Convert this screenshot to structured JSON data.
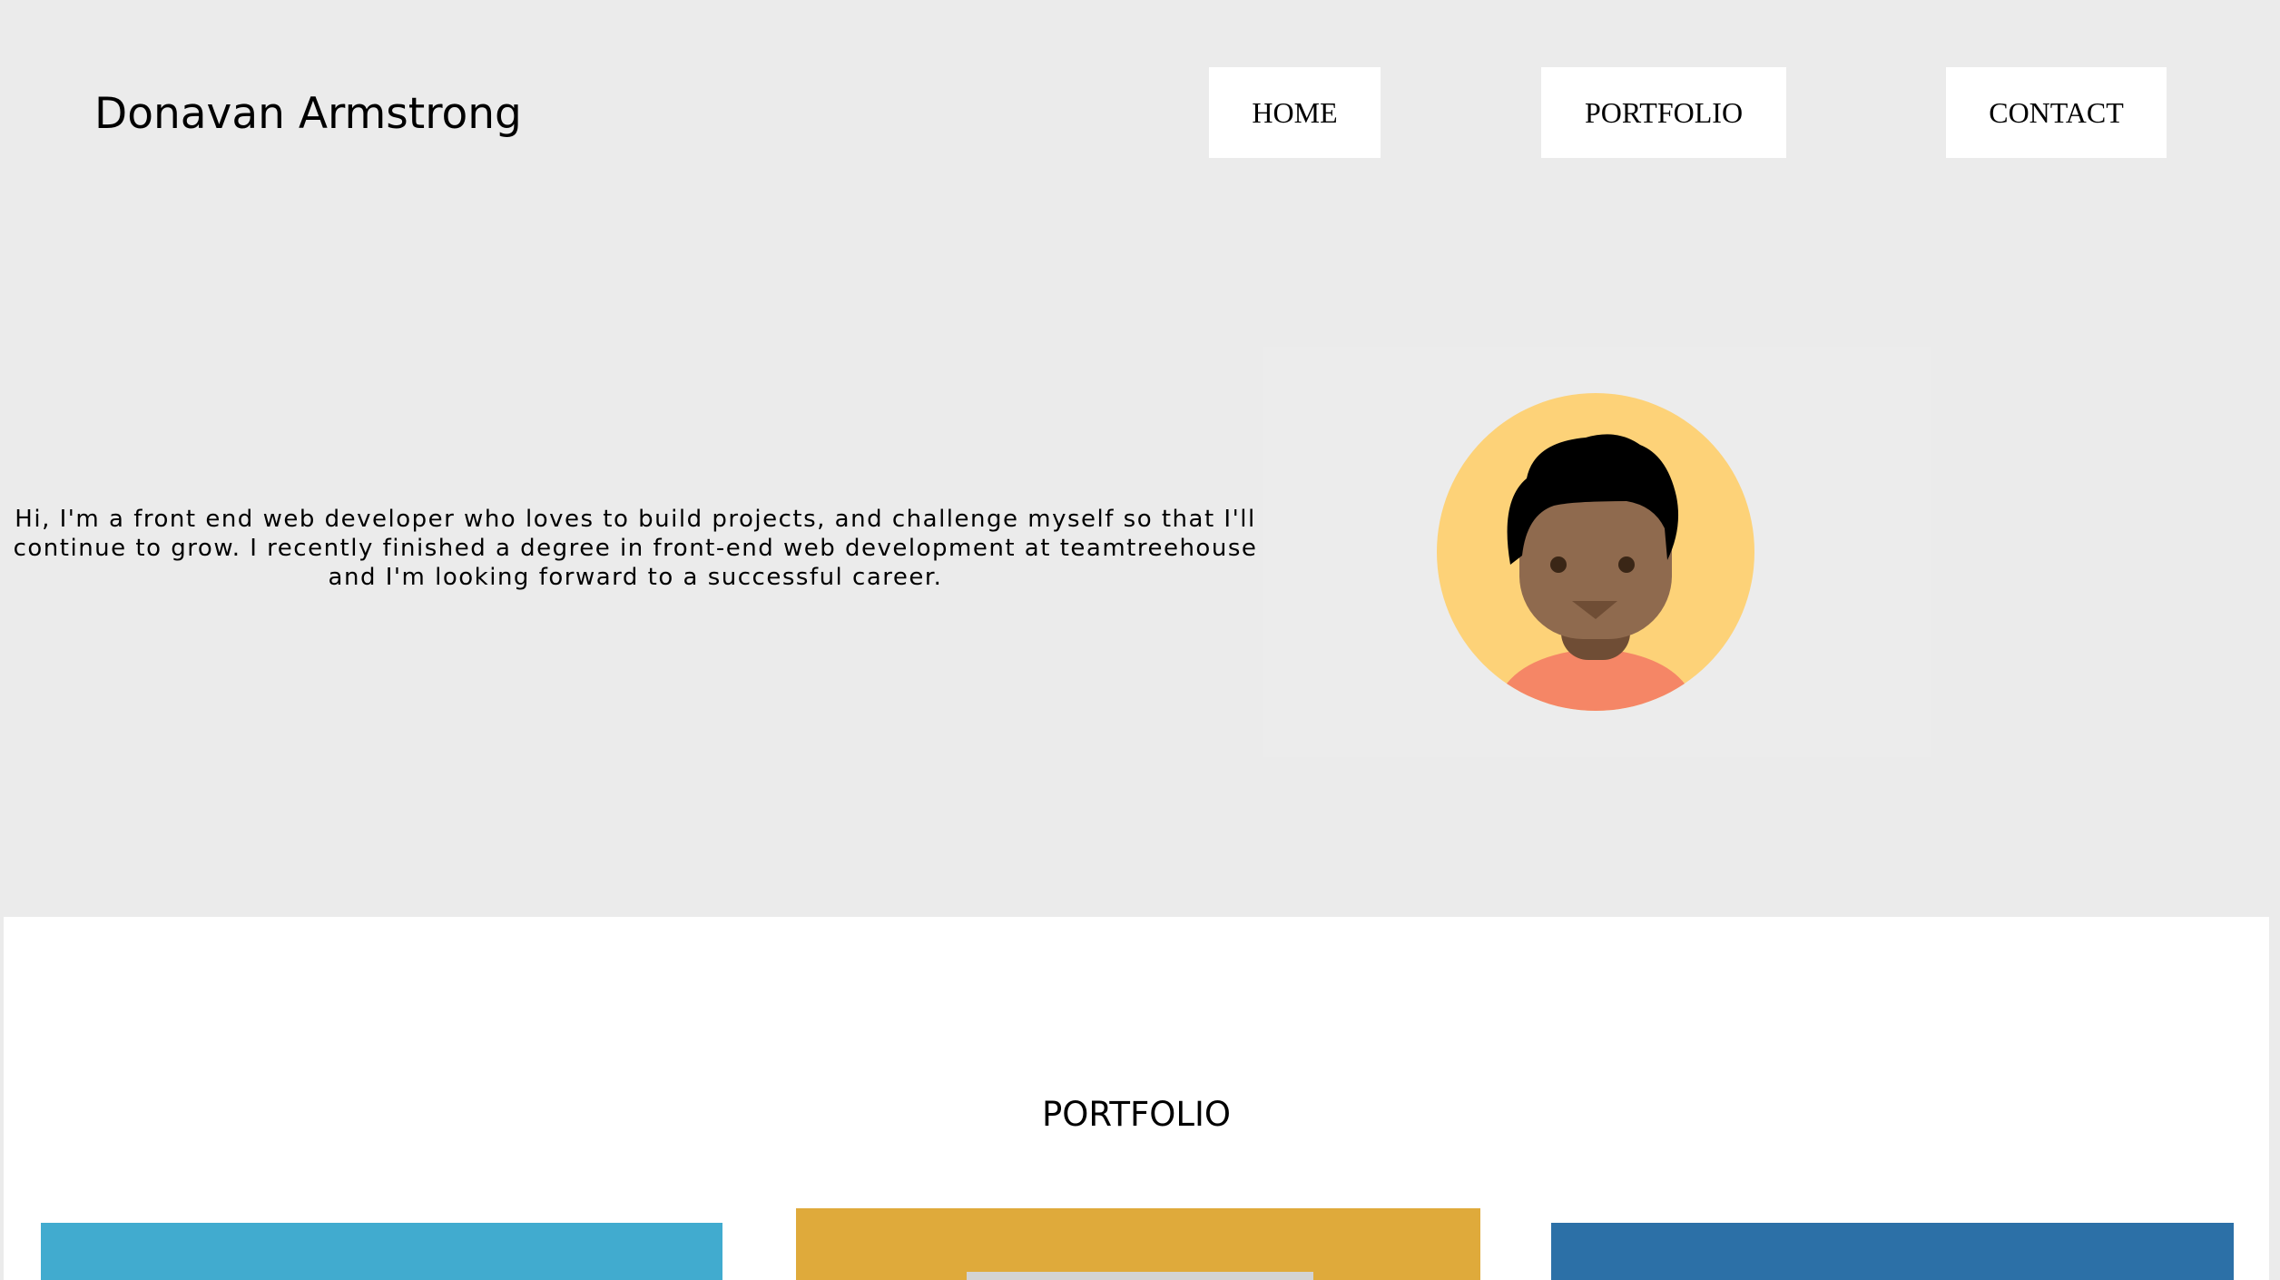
{
  "header": {
    "site_name": "Donavan Armstrong",
    "nav": [
      {
        "label": "HOME"
      },
      {
        "label": "PORTFOLIO"
      },
      {
        "label": "CONTACT"
      }
    ]
  },
  "hero": {
    "intro_text": "Hi, I'm a front end web developer who loves to build projects, and challenge myself so that I'll continue to grow. I recently finished a degree in front-end web development at teamtreehouse and I'm looking forward to a successful career.",
    "avatar_icon": "user-avatar-icon"
  },
  "portfolio": {
    "title": "PORTFOLIO",
    "cards": [
      {
        "color": "#41abcf"
      },
      {
        "color": "#dfaa3b"
      },
      {
        "color": "#2c70a7"
      }
    ]
  },
  "colors": {
    "page_background": "#ebebeb",
    "nav_button_background": "#ffffff",
    "avatar_circle": "#fdd278",
    "avatar_skin": "#8f6a4e",
    "avatar_shirt": "#f58666"
  }
}
